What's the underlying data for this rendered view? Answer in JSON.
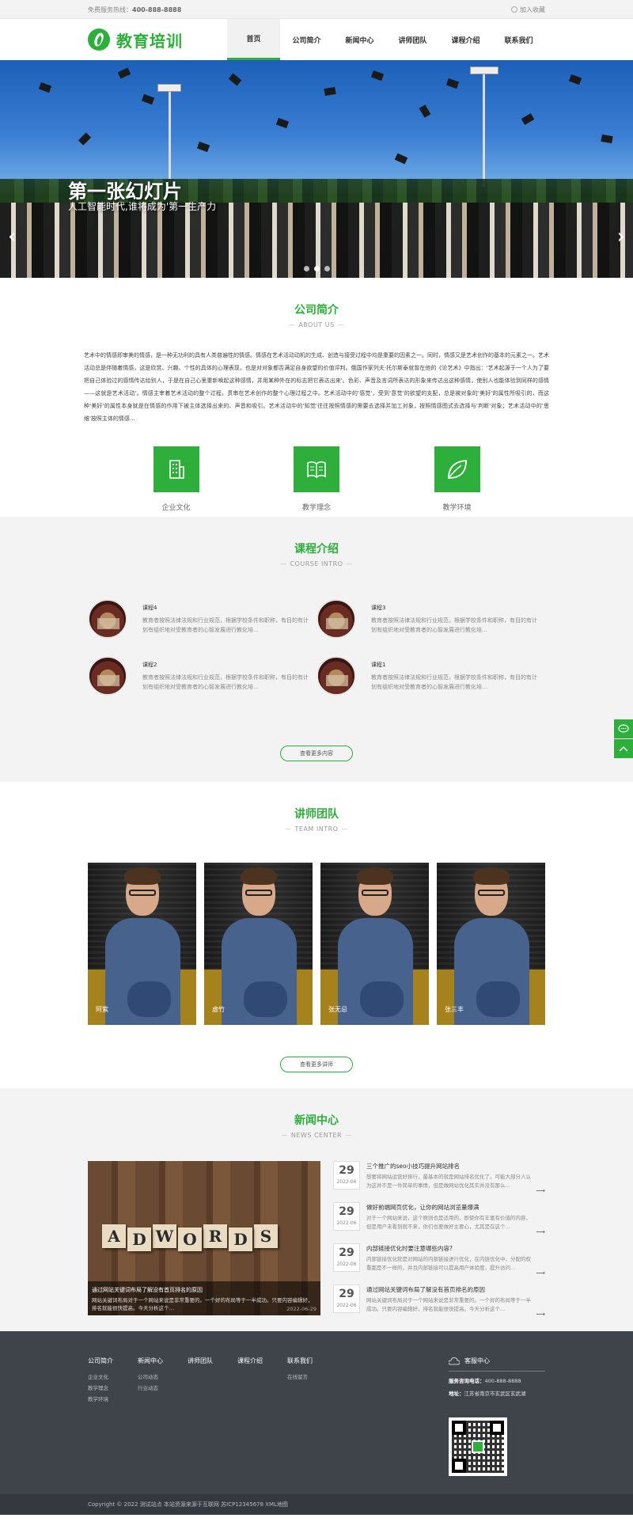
{
  "topbar": {
    "hotline_label": "免费服务热线：",
    "hotline_number": "400-888-8888",
    "favorite": "加入收藏"
  },
  "header": {
    "logo_text": "教育培训",
    "nav": [
      {
        "label": "首页",
        "active": true
      },
      {
        "label": "公司简介",
        "active": false
      },
      {
        "label": "新闻中心",
        "active": false
      },
      {
        "label": "讲师团队",
        "active": false
      },
      {
        "label": "课程介绍",
        "active": false
      },
      {
        "label": "联系我们",
        "active": false
      }
    ]
  },
  "banner": {
    "title": "第一张幻灯片",
    "subtitle": "人工智能时代,谁将成为'第一生产力",
    "prev": "‹",
    "next": "›",
    "slides_total": 3,
    "slide_current": 2
  },
  "about": {
    "title": "公司简介",
    "subtitle": "ABOUT US",
    "text": "艺术中的情感即审美的情感，是一种无功利的具有人类普遍性的情感。情感在艺术活动动机的生成、创造与接受过程中均是重要的因素之一。同时，情感又是艺术创作的基本的元素之一。艺术活动总是伴随着情感，这是欣赏、兴趣、个性的具体的心理表现，也是对对象都否满足自身欲望的价值评判。俄国作家列夫·托尔斯泰就曾在他的《论艺术》中指出：'艺术起源于一个人为了要把自己体验过的感情传达给别人，于是在自己心里重新唤起这种感情，并用某种外在的标志把它表达出来'。色彩、声音及言词所表达的形象来传达出这种感情，使别人也能体验到同样的感情——这就是艺术活动'。情感主宰着艺术活动的整个过程，贯串在艺术创作的整个心理过程之中。艺术活动中的'感觉'，受到'意觉'的欲望的支配，总是被对象的'美好'的属性所吸引的，而这种'美好'的属性本身就是在情感的作用下被主体选择出来的、声音和吸引。艺术活动中的'知觉'往往按照情感的需要去选择并加工对象，按照情感图式去选择与'判断'对象；艺术活动中的'思维'按照主体的情感…",
    "features": [
      {
        "label": "企业文化",
        "icon": "building-icon"
      },
      {
        "label": "教学理念",
        "icon": "book-icon"
      },
      {
        "label": "教学环境",
        "icon": "leaf-icon"
      }
    ]
  },
  "courses": {
    "title": "课程介绍",
    "subtitle": "COURSE INTRO",
    "items": [
      {
        "title": "课程4",
        "desc": "教育者按照法律法规和行业规范，根据学校条件和职称，有目的有计划有组织地对受教育者的心智发展进行教化培…"
      },
      {
        "title": "课程3",
        "desc": "教育者按照法律法规和行业规范，根据学校条件和职称，有目的有计划有组织地对受教育者的心智发展进行教化培…"
      },
      {
        "title": "课程2",
        "desc": "教育者按照法律法规和行业规范，根据学校条件和职称，有目的有计划有组织地对受教育者的心智发展进行教化培…"
      },
      {
        "title": "课程1",
        "desc": "教育者按照法律法规和行业规范，根据学校条件和职称，有目的有计划有组织地对受教育者的心智发展进行教化培…"
      }
    ],
    "more": "查看更多内容"
  },
  "teachers": {
    "title": "讲师团队",
    "subtitle": "TEAM INTRO",
    "items": [
      {
        "name": "阿紫"
      },
      {
        "name": "虚竹"
      },
      {
        "name": "张无忌"
      },
      {
        "name": "张三丰"
      }
    ],
    "more": "查看更多讲师"
  },
  "news": {
    "title": "新闻中心",
    "subtitle": "NEWS CENTER",
    "feature": {
      "image_word": [
        "A",
        "D",
        "W",
        "O",
        "R",
        "D",
        "S"
      ],
      "title": "通过网站关键词布局了解没有首页排名的原因",
      "desc": "网站关键词布局对于一个网站来说是非常重要的。一个好的布局等于一半成功。只要内容编辑好，排名就能很快提高。今天分析这个…",
      "date": "2022-06-29"
    },
    "items": [
      {
        "day": "29",
        "ym": "2022-06",
        "title": "三个推广的seo小技巧提升网站排名",
        "desc": "想要将网站运营好排行，最基本的就是网站排名优化了。可能大部分人认为这并不是一件简单的事情，但是做网站优化其实并没有那么…"
      },
      {
        "day": "29",
        "ym": "2022-06",
        "title": "做好前端网页优化，让你的网站浏览量爆满",
        "desc": "对于一个网站来说，这个原则也是适用的，即使你有丰富有价值的内容，但是用户未看到就不来，你们也要做好主要心，尤其是在这个…"
      },
      {
        "day": "29",
        "ym": "2022-06",
        "title": "内部链接优化时要注意哪些内容?",
        "desc": "内部链接优化就是对网站的内部链接进行优化，在内链优化中，分配的权重都是不一样的，并且内部链接可以提高用户体验度，提升访问…"
      },
      {
        "day": "29",
        "ym": "2022-06",
        "title": "通过网站关键词布局了解没有首页排名的原因",
        "desc": "网站关键词布局对于一个网站来说是非常重要的。一个好的布局等于一半成功。只要内容编辑好，排名就能很快提高。今天分析这个…"
      }
    ],
    "arrow": "⟶"
  },
  "footer": {
    "columns": [
      {
        "title": "公司简介",
        "links": [
          "企业文化",
          "教学理念",
          "教学环境"
        ]
      },
      {
        "title": "新闻中心",
        "links": [
          "公司动态",
          "行业动态"
        ]
      },
      {
        "title": "讲师团队",
        "links": []
      },
      {
        "title": "课程介绍",
        "links": []
      },
      {
        "title": "联系我们",
        "links": [
          "在线留言"
        ]
      }
    ],
    "service_title": "客服中心",
    "phone_label": "服务咨询电话：",
    "phone": "400-888-8888",
    "address_label": "地址：",
    "address": "江苏省南京市玄武区玄武湖",
    "copyright": "Copyright © 2022 测试站点 本站资源来源于互联网 苏ICP12345678 XML地图"
  },
  "colors": {
    "brand": "#2eae3a",
    "footer_bg": "#3f444b"
  }
}
